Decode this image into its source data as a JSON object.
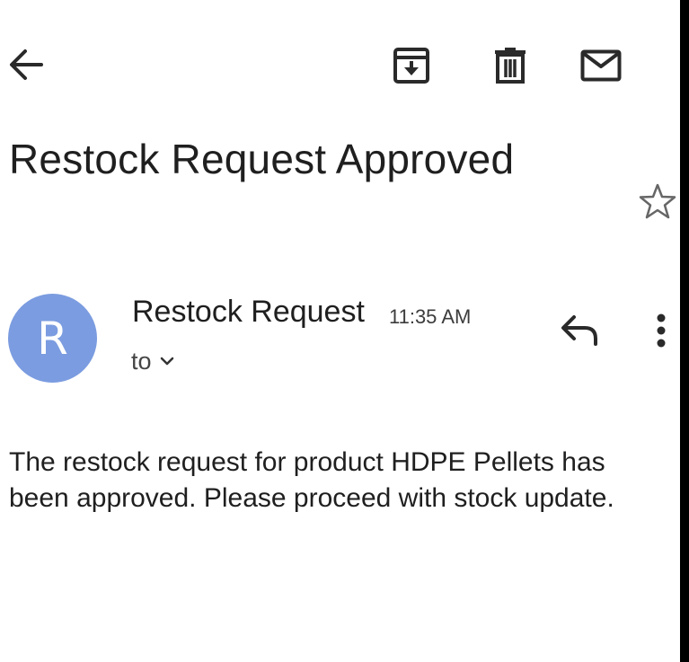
{
  "toolbar": {
    "back_icon": "arrow-left-icon",
    "archive_icon": "archive-icon",
    "delete_icon": "trash-icon",
    "mark_unread_icon": "mail-icon"
  },
  "email": {
    "subject": "Restock Request Approved",
    "star_icon": "star-outline-icon",
    "sender": {
      "avatar_initial": "R",
      "avatar_color": "#7b9ce0",
      "name": "Restock Request",
      "time": "11:35 AM"
    },
    "recipient": {
      "label": "to",
      "expand_icon": "chevron-down-icon"
    },
    "actions": {
      "reply_icon": "reply-icon",
      "more_icon": "more-vert-icon"
    },
    "body": "The restock request for product HDPE Pellets has been approved. Please proceed with stock update."
  }
}
